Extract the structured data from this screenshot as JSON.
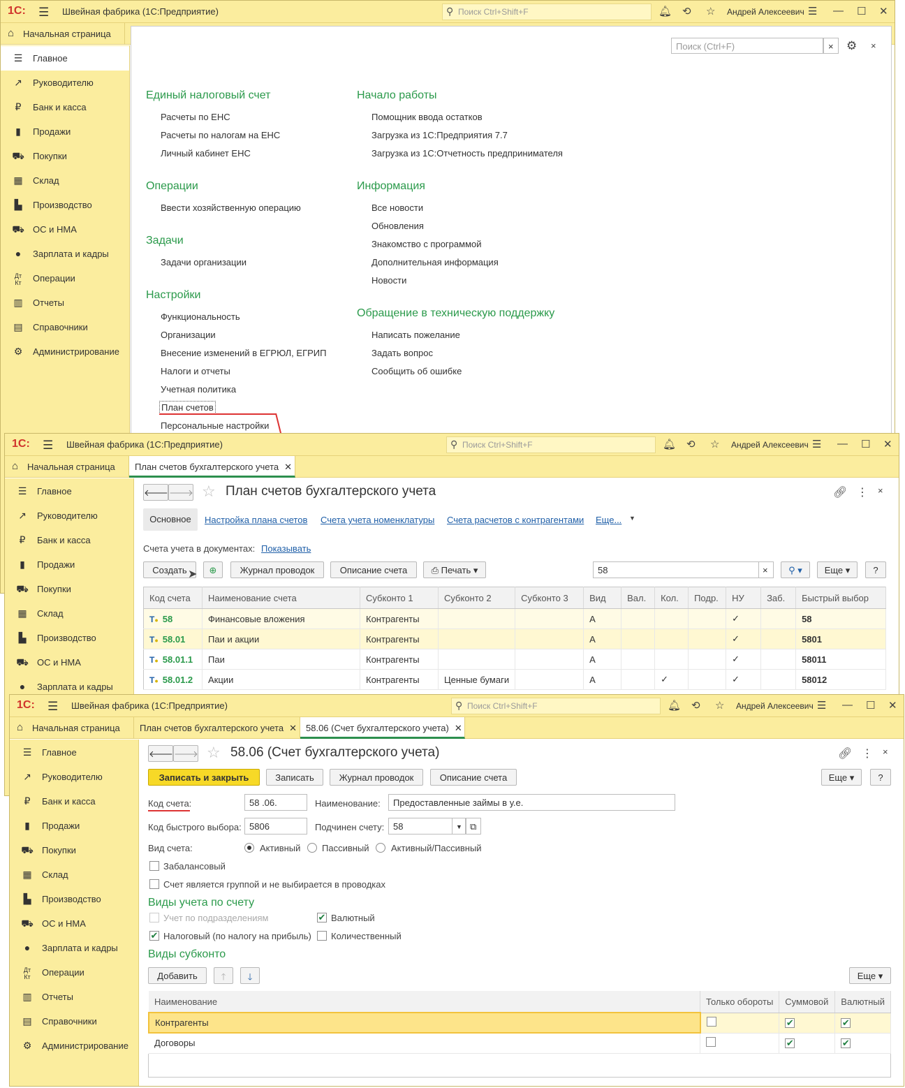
{
  "window1": {
    "title": "Швейная фабрика  (1С:Предприятие)",
    "search_placeholder": "Поиск Ctrl+Shift+F",
    "user": "Андрей Алексеевич",
    "home_tab": "Начальная страница",
    "content_search_placeholder": "Поиск (Ctrl+F)",
    "groups": {
      "ens": {
        "title": "Единый налоговый счет",
        "links": [
          "Расчеты по ЕНС",
          "Расчеты по налогам на ЕНС",
          "Личный кабинет ЕНС"
        ]
      },
      "ops": {
        "title": "Операции",
        "links": [
          "Ввести хозяйственную операцию"
        ]
      },
      "tasks": {
        "title": "Задачи",
        "links": [
          "Задачи организации"
        ]
      },
      "settings": {
        "title": "Настройки",
        "links": [
          "Функциональность",
          "Организации",
          "Внесение изменений в ЕГРЮЛ, ЕГРИП",
          "Налоги и отчеты",
          "Учетная политика",
          "План счетов",
          "Персональные настройки"
        ]
      },
      "start": {
        "title": "Начало работы",
        "links": [
          "Помощник ввода остатков",
          "Загрузка из 1С:Предприятия 7.7",
          "Загрузка из 1С:Отчетность предпринимателя"
        ]
      },
      "info": {
        "title": "Информация",
        "links": [
          "Все новости",
          "Обновления",
          "Знакомство с программой",
          "Дополнительная информация",
          "Новости"
        ]
      },
      "support": {
        "title": "Обращение в техническую поддержку",
        "links": [
          "Написать пожелание",
          "Задать вопрос",
          "Сообщить об ошибке"
        ]
      }
    }
  },
  "sidebar": {
    "items": [
      {
        "label": "Главное",
        "icon": "menu-icon"
      },
      {
        "label": "Руководителю",
        "icon": "trend-icon"
      },
      {
        "label": "Банк и касса",
        "icon": "ruble-icon"
      },
      {
        "label": "Продажи",
        "icon": "bag-icon"
      },
      {
        "label": "Покупки",
        "icon": "cart-icon"
      },
      {
        "label": "Склад",
        "icon": "warehouse-icon"
      },
      {
        "label": "Производство",
        "icon": "factory-icon"
      },
      {
        "label": "ОС и НМА",
        "icon": "truck-icon"
      },
      {
        "label": "Зарплата и кадры",
        "icon": "person-icon"
      },
      {
        "label": "Операции",
        "icon": "dt-kt-icon"
      },
      {
        "label": "Отчеты",
        "icon": "chart-icon"
      },
      {
        "label": "Справочники",
        "icon": "book-icon"
      },
      {
        "label": "Администрирование",
        "icon": "gear-icon"
      }
    ]
  },
  "window2": {
    "title": "Швейная фабрика  (1С:Предприятие)",
    "search_placeholder": "Поиск Ctrl+Shift+F",
    "user": "Андрей Алексеевич",
    "home_tab": "Начальная страница",
    "tab": "План счетов бухгалтерского учета",
    "form_title": "План счетов бухгалтерского учета",
    "subnav": [
      "Основное",
      "Настройка плана счетов",
      "Счета учета номенклатуры",
      "Счета расчетов с контрагентами",
      "Еще..."
    ],
    "docs_label": "Счета учета в документах:",
    "docs_link": "Показывать",
    "buttons": {
      "create": "Создать",
      "journal": "Журнал проводок",
      "desc": "Описание счета",
      "print": "Печать",
      "more": "Еще",
      "help": "?"
    },
    "search_value": "58",
    "columns": [
      "Код счета",
      "Наименование счета",
      "Субконто 1",
      "Субконто 2",
      "Субконто 3",
      "Вид",
      "Вал.",
      "Кол.",
      "Подр.",
      "НУ",
      "Заб.",
      "Быстрый выбор"
    ],
    "rows": [
      {
        "code": "58",
        "name": "Финансовые вложения",
        "s1": "Контрагенты",
        "s2": "",
        "s3": "",
        "kind": "А",
        "val": "",
        "qty": "",
        "dep": "",
        "nu": "✓",
        "zab": "",
        "quick": "58"
      },
      {
        "code": "58.01",
        "name": "Паи и акции",
        "s1": "Контрагенты",
        "s2": "",
        "s3": "",
        "kind": "А",
        "val": "",
        "qty": "",
        "dep": "",
        "nu": "✓",
        "zab": "",
        "quick": "5801"
      },
      {
        "code": "58.01.1",
        "name": "Паи",
        "s1": "Контрагенты",
        "s2": "",
        "s3": "",
        "kind": "А",
        "val": "",
        "qty": "",
        "dep": "",
        "nu": "✓",
        "zab": "",
        "quick": "58011"
      },
      {
        "code": "58.01.2",
        "name": "Акции",
        "s1": "Контрагенты",
        "s2": "Ценные бумаги",
        "s3": "",
        "kind": "А",
        "val": "",
        "qty": "✓",
        "dep": "",
        "nu": "✓",
        "zab": "",
        "quick": "58012"
      }
    ]
  },
  "window3": {
    "title": "Швейная фабрика  (1С:Предприятие)",
    "search_placeholder": "Поиск Ctrl+Shift+F",
    "user": "Андрей Алексеевич",
    "home_tab": "Начальная страница",
    "tab1": "План счетов бухгалтерского учета",
    "tab2": "58.06 (Счет бухгалтерского учета)",
    "form_title": "58.06 (Счет бухгалтерского учета)",
    "buttons": {
      "save_close": "Записать и закрыть",
      "save": "Записать",
      "journal": "Журнал проводок",
      "desc": "Описание счета",
      "more": "Еще",
      "help": "?",
      "add": "Добавить",
      "more2": "Еще"
    },
    "fields": {
      "code_label": "Код счета:",
      "code_value": "58 .06.",
      "name_label": "Наименование:",
      "name_value": "Предоставленные займы в у.е.",
      "quick_label": "Код быстрого выбора:",
      "quick_value": "5806",
      "parent_label": "Подчинен счету:",
      "parent_value": "58",
      "kind_label": "Вид счета:",
      "kind_options": [
        "Активный",
        "Пассивный",
        "Активный/Пассивный"
      ],
      "offbalance": "Забалансовый",
      "is_group": "Счет является группой и не выбирается в проводках"
    },
    "accounting_types": {
      "title": "Виды учета по счету",
      "by_dept": "Учет по подразделениям",
      "currency": "Валютный",
      "tax": "Налоговый (по налогу на прибыль)",
      "quantity": "Количественный"
    },
    "subconto": {
      "title": "Виды субконто",
      "columns": [
        "Наименование",
        "Только обороты",
        "Суммовой",
        "Валютный"
      ],
      "rows": [
        {
          "name": "Контрагенты",
          "turnover": false,
          "sum": true,
          "cur": true
        },
        {
          "name": "Договоры",
          "turnover": false,
          "sum": true,
          "cur": true
        }
      ]
    }
  },
  "colors": {
    "accent_green": "#2b9a4b",
    "bar_yellow": "#fbed9e",
    "button_yellow": "#f7d927",
    "link_blue": "#1f5fa8"
  }
}
